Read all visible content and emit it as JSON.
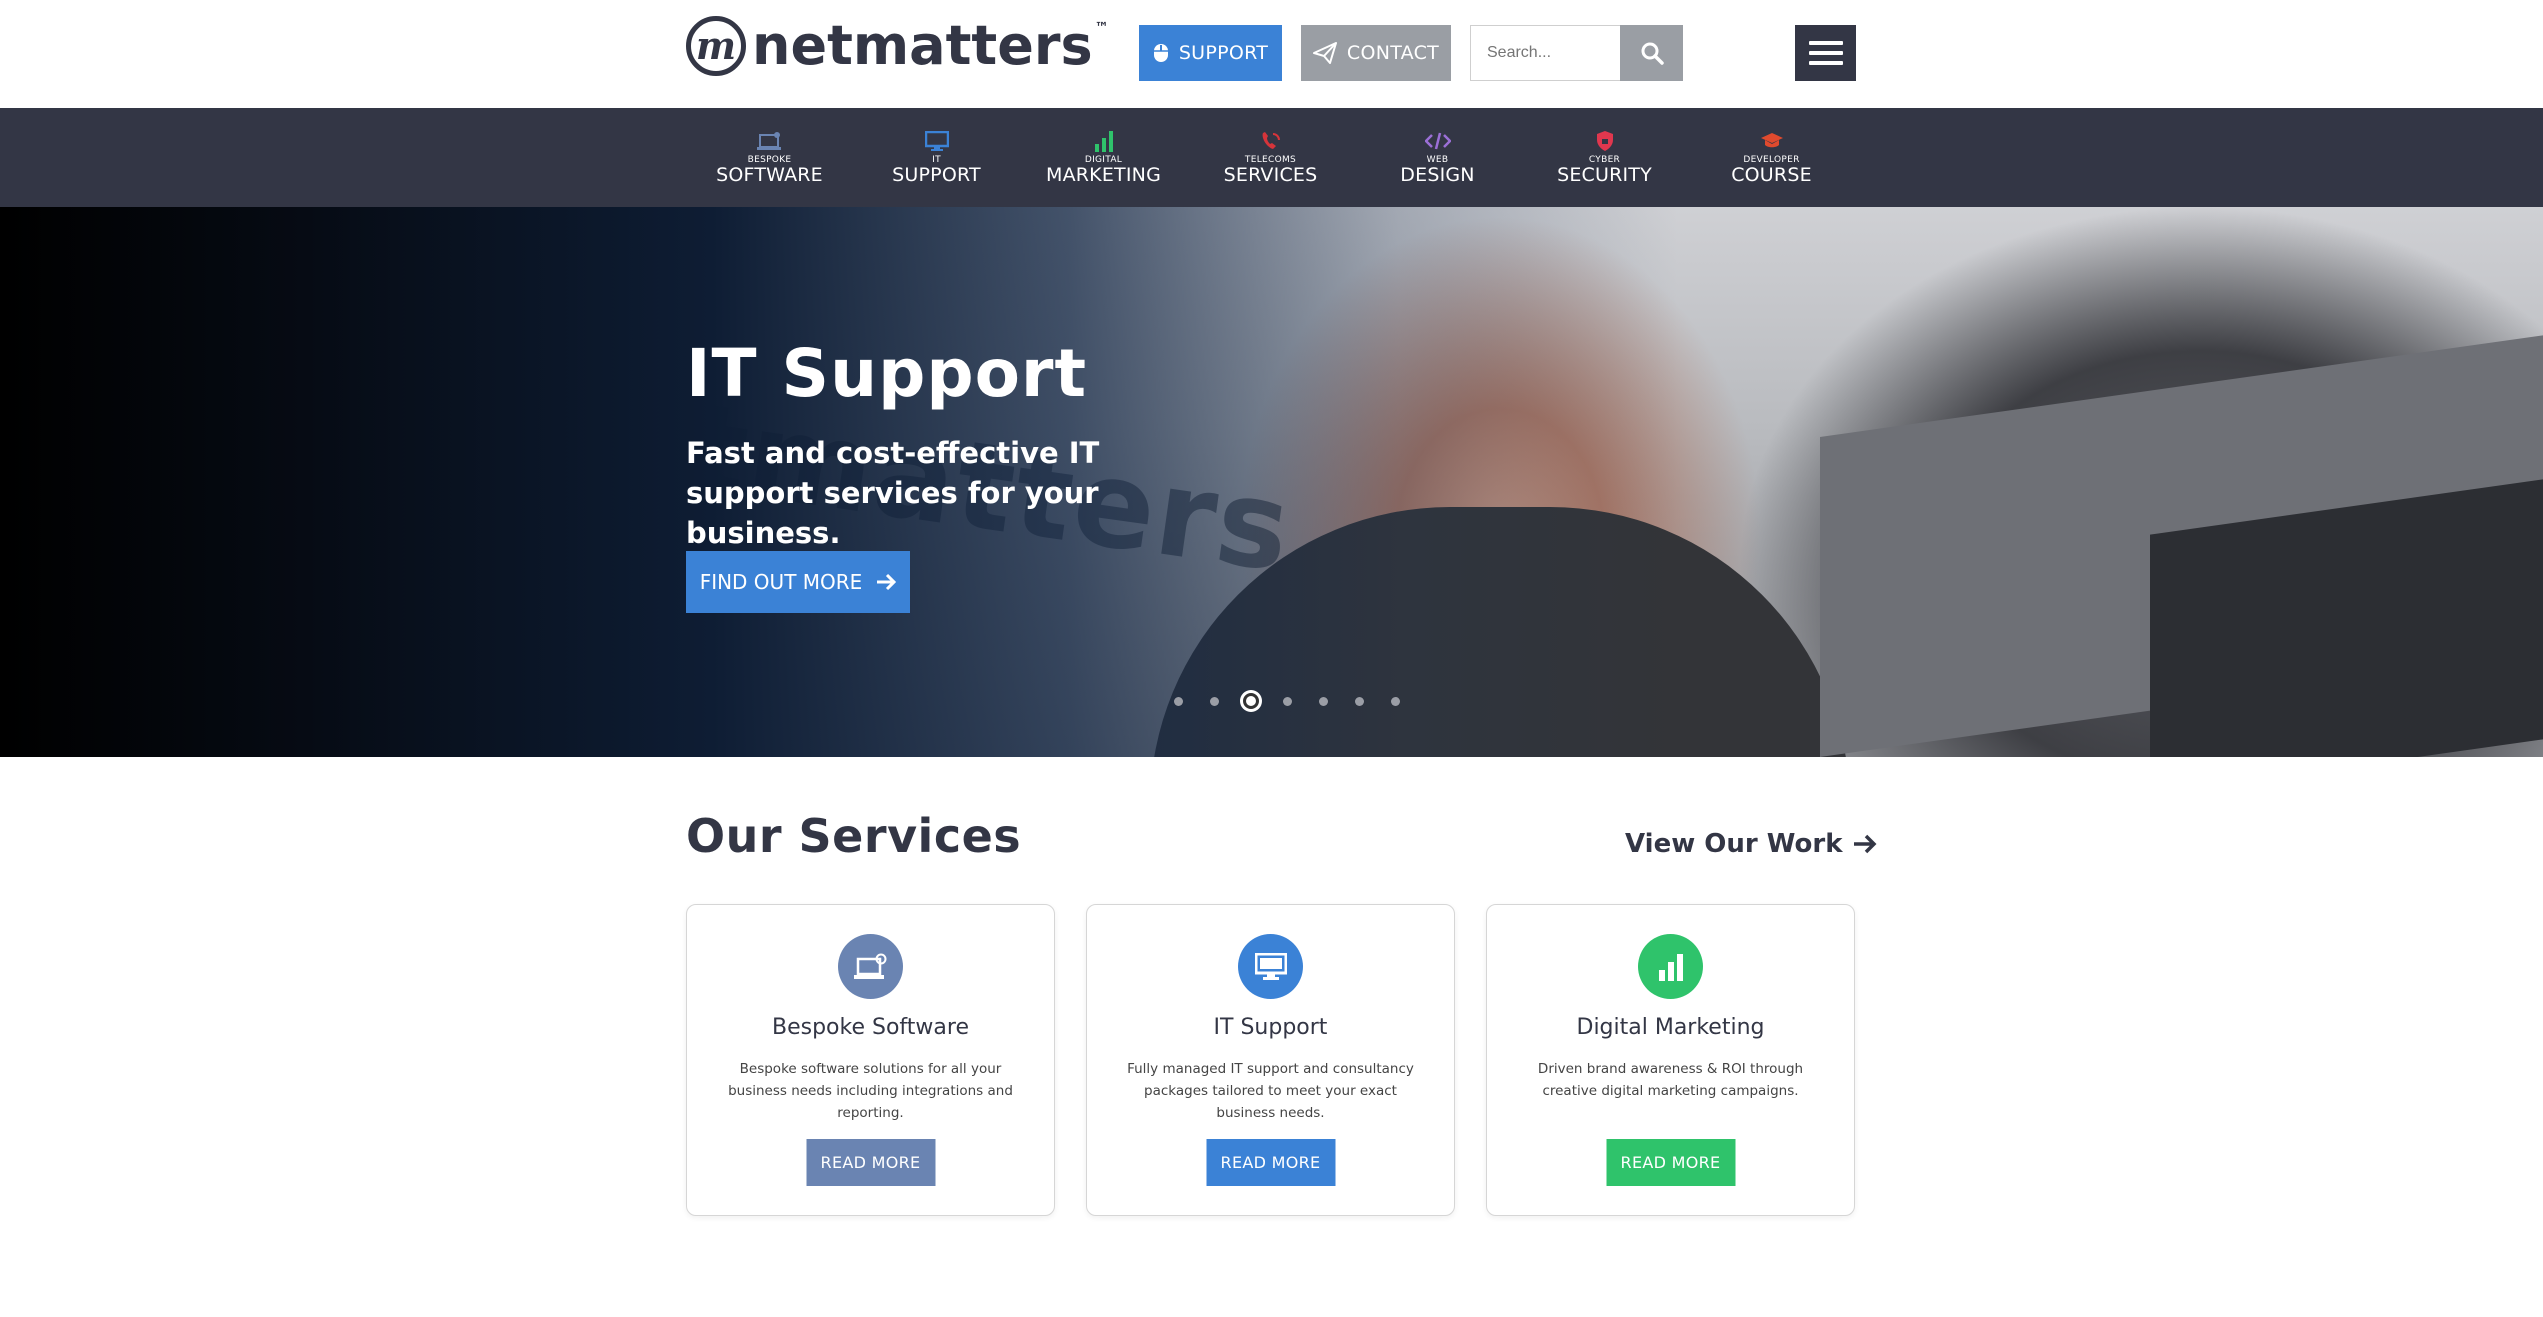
{
  "brand": {
    "logo_mark": "m",
    "name": "netmatters",
    "tm": "™"
  },
  "header": {
    "support_label": "SUPPORT",
    "contact_label": "CONTACT",
    "search_placeholder": "Search...",
    "colors": {
      "support": "#3b82d6",
      "contact": "#9a9ea4",
      "menu": "#333645"
    }
  },
  "nav": {
    "items": [
      {
        "small": "BESPOKE",
        "big": "SOFTWARE",
        "icon": "laptop-gear-icon",
        "color": "#6a84b2"
      },
      {
        "small": "IT",
        "big": "SUPPORT",
        "icon": "monitor-icon",
        "color": "#3b82d6"
      },
      {
        "small": "DIGITAL",
        "big": "MARKETING",
        "icon": "bar-chart-icon",
        "color": "#2fc36b"
      },
      {
        "small": "TELECOMS",
        "big": "SERVICES",
        "icon": "phone-icon",
        "color": "#d6343a"
      },
      {
        "small": "WEB",
        "big": "DESIGN",
        "icon": "code-icon",
        "color": "#9b6fd6"
      },
      {
        "small": "CYBER",
        "big": "SECURITY",
        "icon": "shield-icon",
        "color": "#e0374e"
      },
      {
        "small": "DEVELOPER",
        "big": "COURSE",
        "icon": "graduation-cap-icon",
        "color": "#e04a2e"
      }
    ]
  },
  "hero": {
    "title": "IT Support",
    "subtitle": "Fast and cost-effective IT support services for your business.",
    "button_label": "FIND OUT MORE",
    "wall_text": "tmatters",
    "slides_count": 7,
    "active_slide": 3
  },
  "services": {
    "title": "Our Services",
    "view_work_label": "View Our Work",
    "cards": [
      {
        "title": "Bespoke Software",
        "desc": "Bespoke software solutions for all your business needs including integrations and reporting.",
        "button": "READ MORE",
        "color": "#6a84b2",
        "icon": "laptop-gear-icon"
      },
      {
        "title": "IT Support",
        "desc": "Fully managed IT support and consultancy packages tailored to meet your exact business needs.",
        "button": "READ MORE",
        "color": "#3b82d6",
        "icon": "monitor-icon"
      },
      {
        "title": "Digital Marketing",
        "desc": "Driven brand awareness & ROI through creative digital marketing campaigns.",
        "button": "READ MORE",
        "color": "#2fc36b",
        "icon": "bar-chart-icon"
      }
    ]
  }
}
